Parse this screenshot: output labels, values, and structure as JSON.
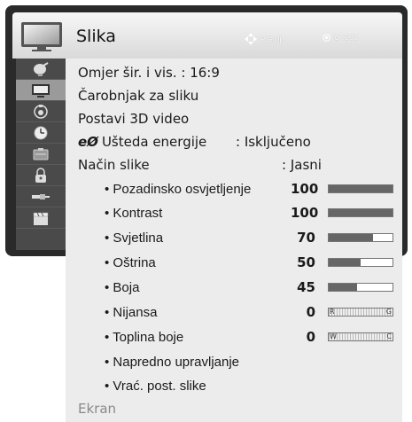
{
  "header": {
    "title": "Slika",
    "hint_move": "Premj.",
    "hint_ok": "U redu"
  },
  "sidebar": {
    "items": [
      {
        "icon": "satellite-dish-icon",
        "active": false
      },
      {
        "icon": "tv-picture-icon",
        "active": true
      },
      {
        "icon": "speaker-icon",
        "active": false
      },
      {
        "icon": "clock-icon",
        "active": false
      },
      {
        "icon": "options-icon",
        "active": false
      },
      {
        "icon": "lock-icon",
        "active": false
      },
      {
        "icon": "input-cable-icon",
        "active": false
      },
      {
        "icon": "clapperboard-icon",
        "active": false
      }
    ]
  },
  "menu": {
    "aspect": "Omjer šir. i vis. : 16:9",
    "wizard": "Čarobnjak za sliku",
    "video3d": "Postavi 3D video",
    "energy_glyph": "eØ",
    "energy_label": "Ušteda energije",
    "energy_value": ": Isključeno",
    "mode_label": "Način slike",
    "mode_value": ": Jasni",
    "items": [
      {
        "label": "• Pozadinsko osvjetljenje",
        "value": "100",
        "level": 100
      },
      {
        "label": "• Kontrast",
        "value": "100",
        "level": 100
      },
      {
        "label": "• Svjetlina",
        "value": "70",
        "level": 70
      },
      {
        "label": "• Oštrina",
        "value": "50",
        "level": 50
      },
      {
        "label": "• Boja",
        "value": "45",
        "level": 45
      }
    ],
    "tint": {
      "label": "• Nijansa",
      "value": "0",
      "left_mark": "R",
      "right_mark": "G"
    },
    "color_temp": {
      "label": "•  Toplina boje",
      "value": "0",
      "left_mark": "W",
      "right_mark": "C"
    },
    "advanced": "• Napredno upravljanje",
    "reset": "• Vrać. post. slike",
    "screen": "Ekran"
  }
}
